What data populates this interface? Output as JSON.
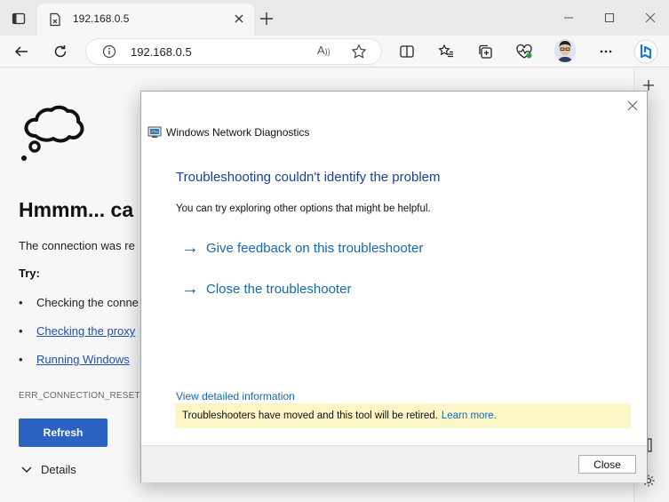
{
  "browser": {
    "tab_title": "192.168.0.5",
    "address": "192.168.0.5",
    "read_aloud_label": "A¹¹"
  },
  "page": {
    "title": "Hmmm... ca",
    "description": "The connection was re",
    "try_label": "Try:",
    "suggestions": [
      {
        "text": "Checking the conne",
        "link": false
      },
      {
        "text": "Checking the proxy",
        "link": true
      },
      {
        "text": "Running Windows",
        "link": true
      }
    ],
    "error_code": "ERR_CONNECTION_RESET",
    "refresh_label": "Refresh",
    "details_label": "Details"
  },
  "dialog": {
    "window_title": "Windows Network Diagnostics",
    "heading": "Troubleshooting couldn't identify the problem",
    "subtext": "You can try exploring other options that might be helpful.",
    "options": [
      {
        "label": "Give feedback on this troubleshooter"
      },
      {
        "label": "Close the troubleshooter"
      }
    ],
    "detail_link": "View detailed information",
    "banner_text": "Troubleshooters have moved and this tool will be retired.",
    "banner_link": "Learn more.",
    "close_button": "Close"
  },
  "icons": {
    "arrow": "→",
    "bullet": "•"
  },
  "colors": {
    "accent_blue": "#2b63c2",
    "dialog_link": "#1469b3",
    "dialog_heading": "#1c3f95",
    "banner_bg": "#fcf6c6"
  }
}
